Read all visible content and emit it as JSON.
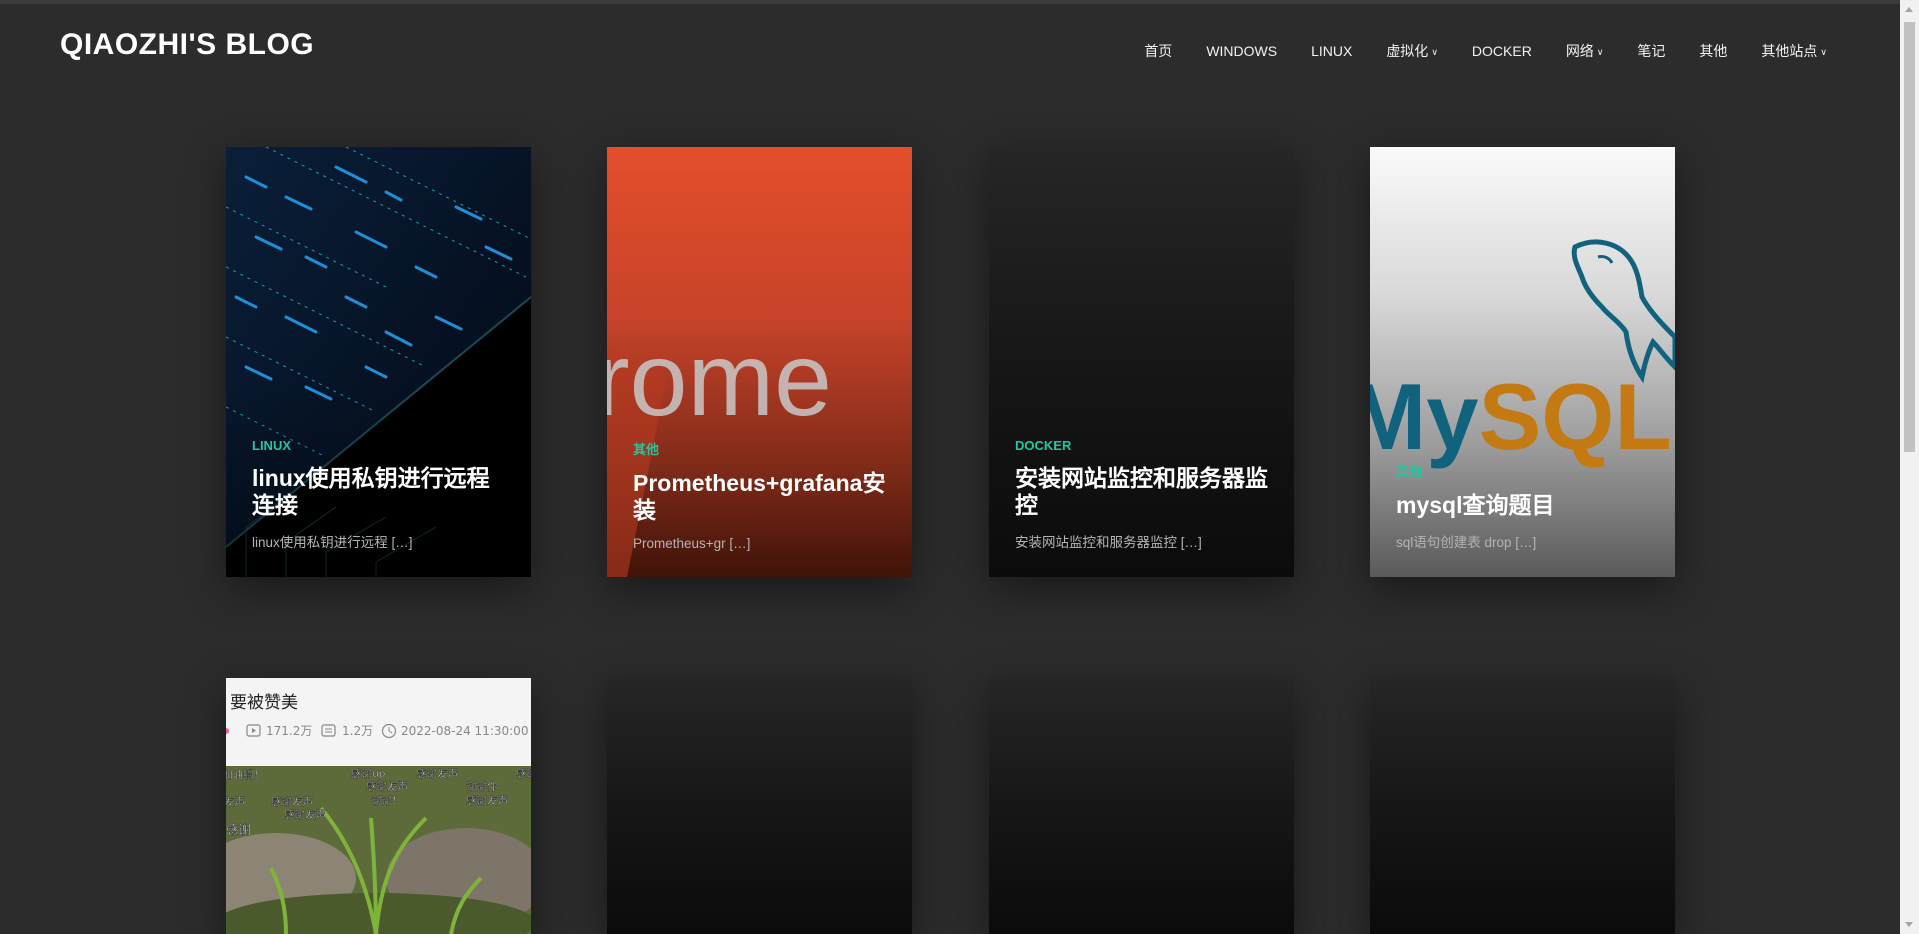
{
  "site": {
    "title": "QIAOZHI'S BLOG"
  },
  "nav": {
    "items": [
      {
        "label": "首页",
        "dropdown": false
      },
      {
        "label": "WINDOWS",
        "dropdown": false
      },
      {
        "label": "LINUX",
        "dropdown": false
      },
      {
        "label": "虚拟化",
        "dropdown": true
      },
      {
        "label": "DOCKER",
        "dropdown": false
      },
      {
        "label": "网络",
        "dropdown": true
      },
      {
        "label": "笔记",
        "dropdown": false
      },
      {
        "label": "其他",
        "dropdown": false
      },
      {
        "label": "其他站点",
        "dropdown": true
      }
    ]
  },
  "posts": [
    {
      "category": "LINUX",
      "title": "linux使用私钥进行远程连接",
      "excerpt": "linux使用私钥进行远程 […]"
    },
    {
      "category": "其他",
      "title": "Prometheus+grafana安装",
      "excerpt": "Prometheus+gr […]",
      "image_text": "rome"
    },
    {
      "category": "DOCKER",
      "title": "安装网站监控和服务器监控",
      "excerpt": "安装网站监控和服务器监控 […]"
    },
    {
      "category": "其他",
      "title": "mysql查询题目",
      "excerpt": "sql语句创建表 drop […]",
      "image_text": "MySQL"
    }
  ],
  "second_row": {
    "screenshot": {
      "heading": "要被赞美",
      "views": "171.2万",
      "comments": "1.2万",
      "datetime": "2022-08-24 11:30:00",
      "danmaku": [
        "加油啊！",
        "感谢up",
        "感谢发声",
        "谢谢你",
        "感谢发声",
        "感谢发声",
        "发声",
        "谢谢！",
        "感谢发声",
        "感谢发声",
        "感谢",
        "感谢"
      ]
    }
  },
  "colors": {
    "background": "#2c2c2c",
    "accent": "#22c7a0"
  }
}
